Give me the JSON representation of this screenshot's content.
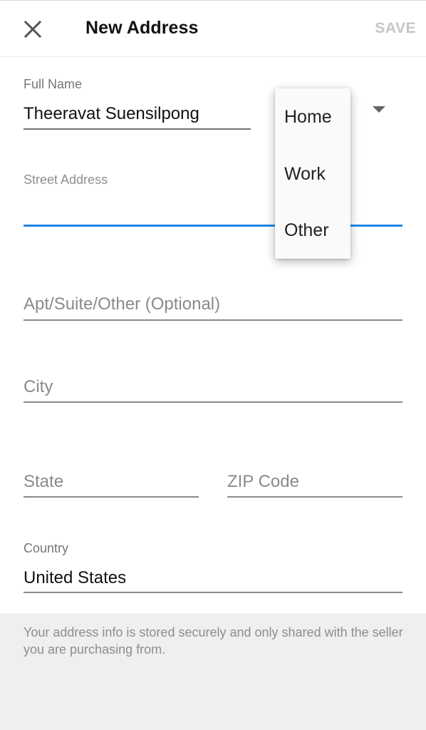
{
  "header": {
    "title": "New Address",
    "save_label": "SAVE",
    "close_icon": "close-icon"
  },
  "form": {
    "full_name": {
      "label": "Full Name",
      "value": "Theeravat Suensilpong"
    },
    "address_type": {
      "options": [
        "Home",
        "Work",
        "Other"
      ],
      "icon": "dropdown-arrow-icon"
    },
    "street_address": {
      "label": "Street Address",
      "value": ""
    },
    "apt": {
      "placeholder": "Apt/Suite/Other (Optional)"
    },
    "city": {
      "placeholder": "City"
    },
    "state": {
      "placeholder": "State"
    },
    "zip": {
      "placeholder": "ZIP Code"
    },
    "country": {
      "label": "Country",
      "value": "United States"
    }
  },
  "footer": {
    "note": "Your address info is stored securely and only shared with the seller you are purchasing from."
  },
  "colors": {
    "accent": "#1e88e5",
    "background": "#efefef",
    "surface": "#ffffff",
    "disabled_text": "#c6c6c6"
  }
}
